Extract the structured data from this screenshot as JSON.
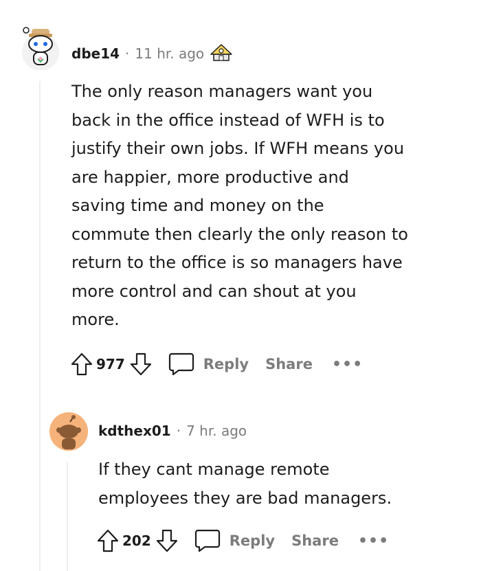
{
  "comments": [
    {
      "username": "dbe14",
      "separator": "·",
      "time": "11 hr. ago",
      "award_icon": "award-icon",
      "body_lines": [
        "The only reason managers want you",
        "back in the office instead of WFH is to",
        "justify their own jobs. If WFH means you",
        "are happier, more productive and",
        "saving time and money on the",
        "commute then clearly the only reason to",
        "return to the office is so managers have",
        "more control and can shout at you",
        "more."
      ],
      "votes": "977",
      "reply_label": "Reply",
      "share_label": "Share",
      "more_label": "•••"
    },
    {
      "username": "kdthex01",
      "separator": "·",
      "time": "7 hr. ago",
      "body_lines": [
        "If they cant manage remote",
        "employees they are bad managers."
      ],
      "votes": "202",
      "reply_label": "Reply",
      "share_label": "Share",
      "more_label": "•••"
    }
  ],
  "colors": {
    "text": "#1c1c1c",
    "muted": "#7c7c7c",
    "thread_line": "#ededed",
    "avatar2_bg": "#f5b27a"
  }
}
